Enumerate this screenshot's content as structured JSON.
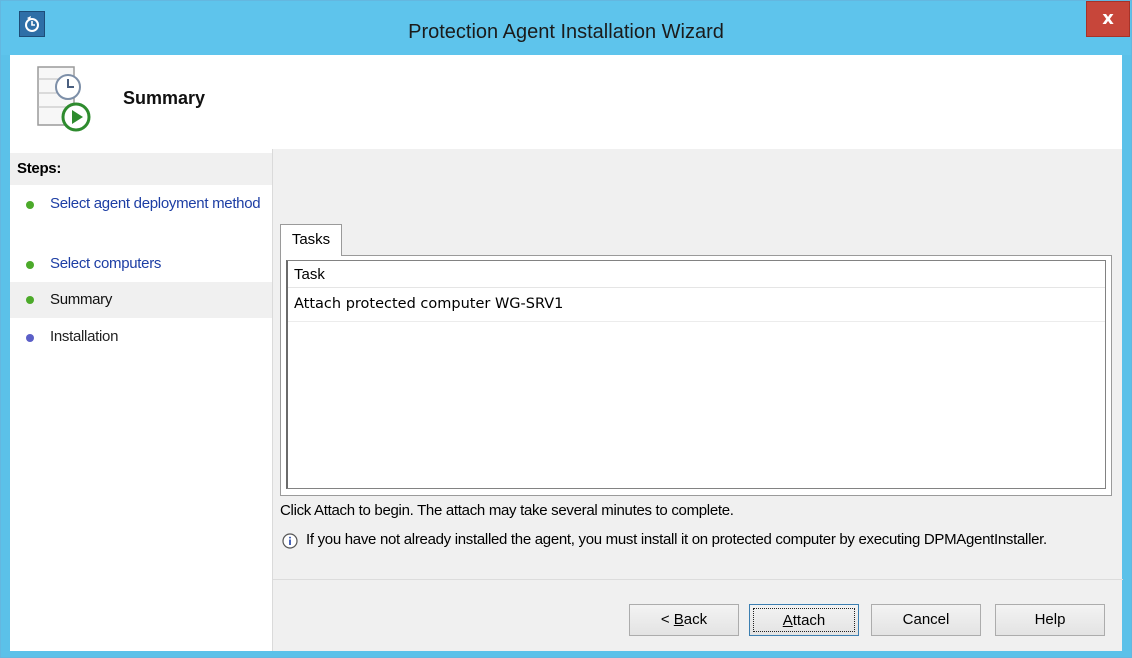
{
  "window": {
    "title": "Protection Agent Installation Wizard",
    "close_label": "x",
    "icons": {
      "app": "dpm-app-icon",
      "close": "close-icon"
    }
  },
  "header": {
    "title": "Summary",
    "icon": "schedule-play-icon"
  },
  "steps": {
    "heading": "Steps:",
    "items": [
      {
        "label": "Select agent deployment method",
        "state": "completed"
      },
      {
        "label": "Select computers",
        "state": "completed"
      },
      {
        "label": "Summary",
        "state": "current"
      },
      {
        "label": "Installation",
        "state": "pending"
      }
    ]
  },
  "tasks": {
    "tab_label": "Tasks",
    "column_header": "Task",
    "rows": [
      {
        "task": "Attach protected computer WG-SRV1"
      }
    ]
  },
  "messages": {
    "instruction": "Click Attach to begin. The attach may take several minutes to complete.",
    "info": "If you have not already installed the agent, you must install it on protected computer by executing DPMAgentInstaller.",
    "info_icon": "info-icon"
  },
  "buttons": {
    "back": {
      "prefix": "< ",
      "accel": "B",
      "rest": "ack"
    },
    "attach": {
      "prefix": "",
      "accel": "A",
      "rest": "ttach"
    },
    "cancel": "Cancel",
    "help": "Help"
  },
  "colors": {
    "titlebar": "#5ec4ec",
    "close": "#c7463a",
    "completed_dot": "#4caa2a",
    "pending_dot": "#5b5fc7",
    "link": "#1d3ea4"
  }
}
